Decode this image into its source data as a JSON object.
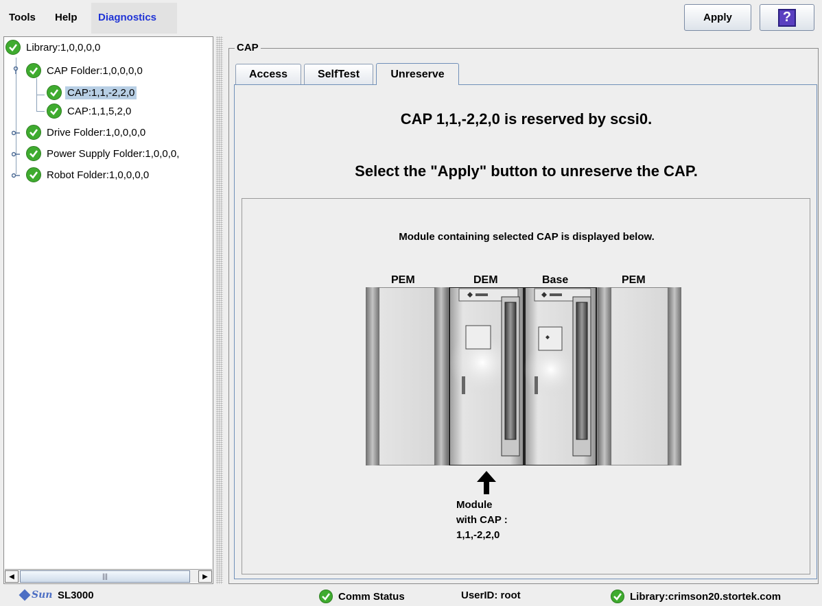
{
  "menu": {
    "tools": "Tools",
    "help": "Help",
    "diagnostics": "Diagnostics"
  },
  "toolbar": {
    "apply_label": "Apply",
    "help_icon_label": "?"
  },
  "tree": {
    "items": [
      {
        "label": "Library:1,0,0,0,0",
        "icon": "check-circle-icon"
      },
      {
        "label": "CAP Folder:1,0,0,0,0",
        "icon": "check-circle-icon"
      },
      {
        "label": "CAP:1,1,-2,2,0",
        "icon": "check-circle-icon",
        "selected": true
      },
      {
        "label": "CAP:1,1,5,2,0",
        "icon": "check-circle-icon"
      },
      {
        "label": "Drive Folder:1,0,0,0,0",
        "icon": "check-circle-icon"
      },
      {
        "label": "Power Supply Folder:1,0,0,0,",
        "icon": "check-circle-icon"
      },
      {
        "label": "Robot Folder:1,0,0,0,0",
        "icon": "check-circle-icon"
      }
    ]
  },
  "panel": {
    "title": "CAP",
    "tabs": [
      "Access",
      "SelfTest",
      "Unreserve"
    ],
    "active_tab": "Unreserve",
    "message_reserved": "CAP 1,1,-2,2,0 is reserved by scsi0.",
    "message_apply": "Select the \"Apply\" button to unreserve the CAP.",
    "module_caption": "Module containing selected CAP is displayed below.",
    "module_labels": [
      "PEM",
      "DEM",
      "Base",
      "PEM"
    ],
    "module_note": [
      "Module",
      "with CAP :",
      "1,1,-2,2,0"
    ]
  },
  "status": {
    "brand": "Sun",
    "product": "SL3000",
    "comm": "Comm Status",
    "user": "UserID: root",
    "library": "Library:crimson20.stortek.com"
  },
  "colors": {
    "accent_menu": "#1f33d6",
    "ok_green": "#3fab2f",
    "selection": "#b8cfe5"
  }
}
